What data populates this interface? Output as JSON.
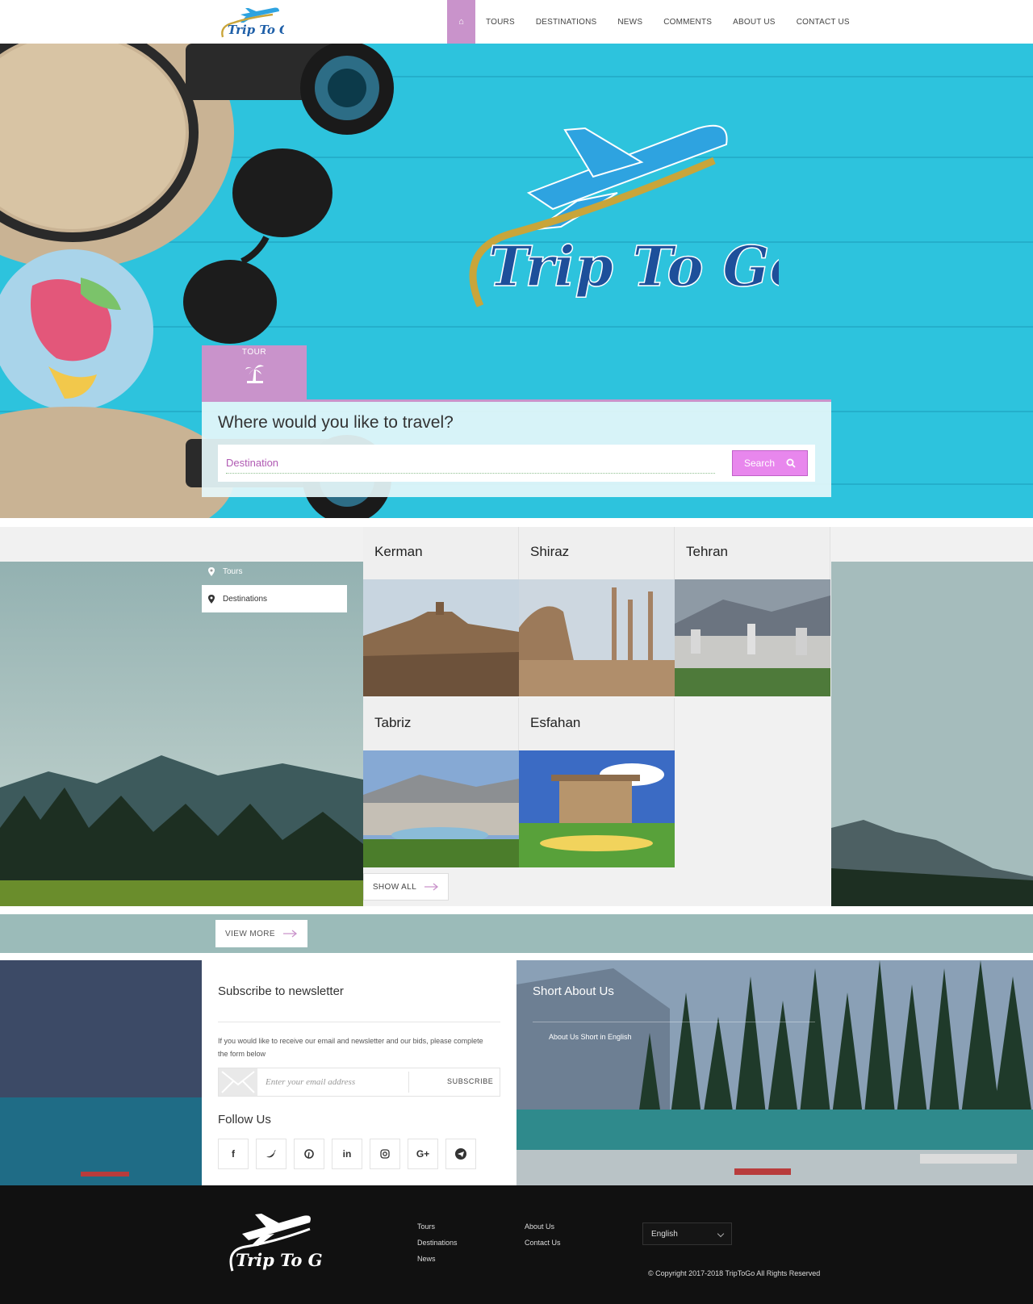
{
  "header": {
    "logo_text": "Trip To Go",
    "nav": [
      "TOURS",
      "DESTINATIONS",
      "NEWS",
      "COMMENTS",
      "ABOUT US",
      "CONTACT US"
    ]
  },
  "hero": {
    "logo_text": "Trip To Go",
    "tab_label": "TOUR",
    "search_title": "Where would you like to travel?",
    "destination_placeholder": "Destination",
    "search_button": "Search"
  },
  "destinations": {
    "side_tabs": [
      "Tours",
      "Destinations"
    ],
    "active_tab": "Destinations",
    "cards": [
      "Kerman",
      "Shiraz",
      "Tehran",
      "Tabriz",
      "Esfahan"
    ],
    "show_all": "SHOW ALL"
  },
  "view_more": "VIEW MORE",
  "newsletter": {
    "title": "Subscribe to newsletter",
    "text": "If you would like to receive our email and newsletter and our bids, please complete the form below",
    "email_placeholder": "Enter your email address",
    "subscribe": "SUBSCRIBE",
    "follow_title": "Follow Us",
    "socials": [
      "facebook-icon",
      "twitter-icon",
      "pinterest-icon",
      "linkedin-icon",
      "instagram-icon",
      "google-plus-icon",
      "telegram-icon"
    ]
  },
  "about": {
    "title": "Short About Us",
    "text": "About Us Short in English"
  },
  "footer": {
    "col1": [
      "Tours",
      "Destinations",
      "News"
    ],
    "col2": [
      "About Us",
      "Contact Us"
    ],
    "language": "English",
    "copyright": "© Copyright 2017-2018 TripToGo All Rights Reserved"
  },
  "colors": {
    "accent": "#c993cb",
    "search_button": "#e887ed",
    "hero_bg": "#2dc3dd",
    "footer_bg": "#111111"
  }
}
